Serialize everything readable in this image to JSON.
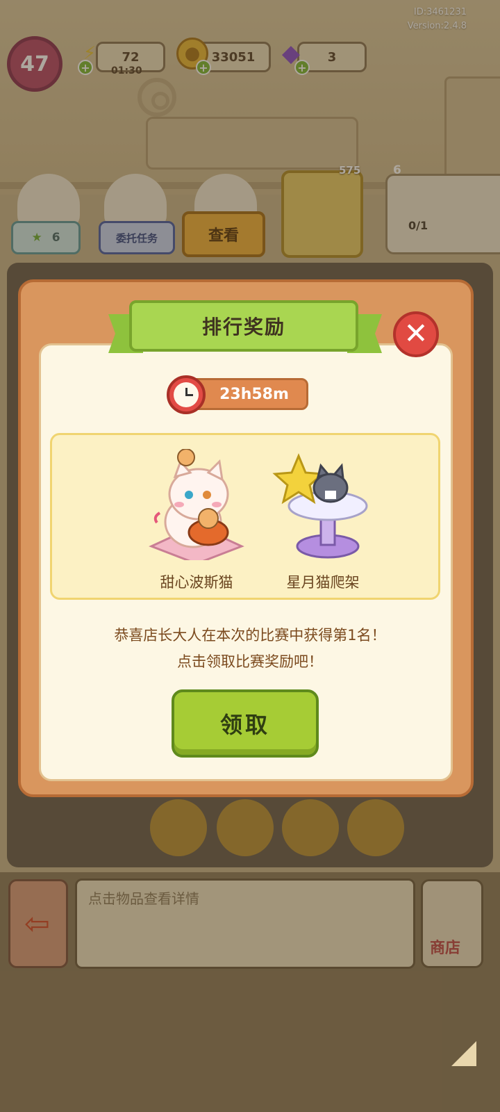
{
  "meta": {
    "id_text": "ID:3461231",
    "version_text": "Version:2.4.8"
  },
  "hud": {
    "level": "47",
    "energy": "72",
    "energy_timer": "01:30",
    "coins": "33051",
    "gems": "3"
  },
  "characters": {
    "star_count_left": "6",
    "task_button": "委托任务",
    "view_button": "查看",
    "book_count": "575",
    "machine_stars": "6",
    "machine_progress": "0/1"
  },
  "modal": {
    "title": "排行奖励",
    "timer": "23h58m",
    "rewards": [
      {
        "name": "甜心波斯猫"
      },
      {
        "name": "星月猫爬架"
      }
    ],
    "congrats_line1": "恭喜店长大人在本次的比赛中获得第1名！",
    "congrats_line2": "点击领取比赛奖励吧！",
    "claim_label": "领取"
  },
  "bottom": {
    "info_placeholder": "点击物品查看详情",
    "shop_label": "商店"
  },
  "colors": {
    "accent_green": "#a6cc35",
    "modal_orange": "#d9965e",
    "close_red": "#e14a42"
  }
}
